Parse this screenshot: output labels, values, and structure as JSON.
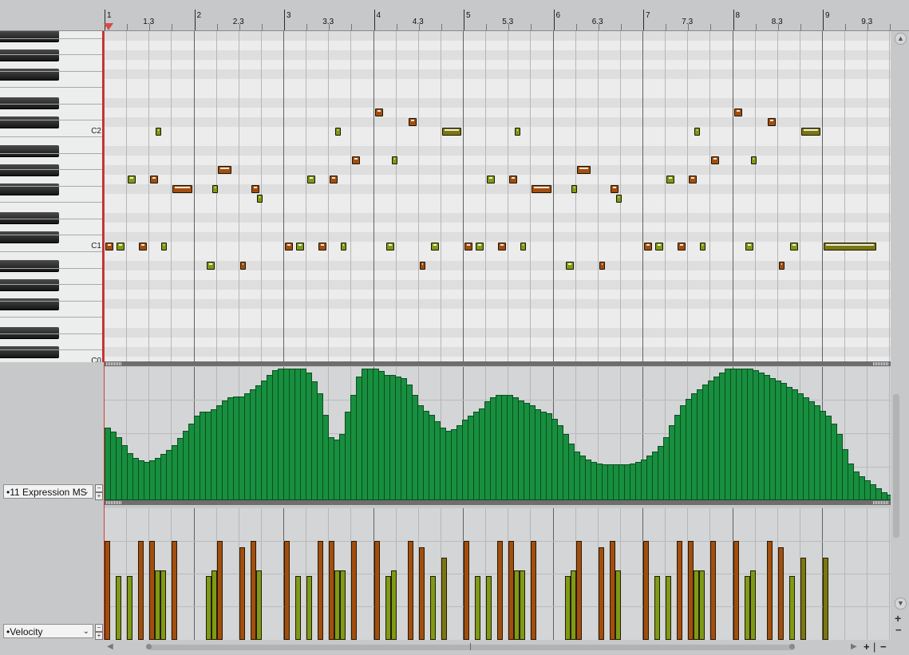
{
  "ruler": {
    "labels": [
      "1",
      "1.3",
      "2",
      "2.3",
      "3",
      "3.3",
      "4",
      "4.3",
      "5",
      "5.3",
      "6",
      "6.3",
      "7",
      "7.3",
      "8",
      "8.3",
      "9",
      "9.3"
    ]
  },
  "keyboard": {
    "labels": [
      "C2",
      "C1",
      "C0"
    ]
  },
  "notes": [
    {
      "bar": 1,
      "beat": 1.0,
      "len": 0.5,
      "pitch": "C1",
      "vel": "orange"
    },
    {
      "bar": 1,
      "beat": 1.5,
      "len": 0.5,
      "pitch": "C1",
      "vel": "green"
    },
    {
      "bar": 1,
      "beat": 2.0,
      "len": 0.5,
      "pitch": "G1",
      "vel": "green"
    },
    {
      "bar": 1,
      "beat": 2.5,
      "len": 0.5,
      "pitch": "C1",
      "vel": "orange"
    },
    {
      "bar": 1,
      "beat": 3.0,
      "len": 0.5,
      "pitch": "G1",
      "vel": "orange"
    },
    {
      "bar": 1,
      "beat": 3.25,
      "len": 0.25,
      "pitch": "C2",
      "vel": "green"
    },
    {
      "bar": 1,
      "beat": 3.5,
      "len": 0.25,
      "pitch": "C1",
      "vel": "green"
    },
    {
      "bar": 1,
      "beat": 4.0,
      "len": 1.0,
      "pitch": "F#1",
      "vel": "orange"
    },
    {
      "bar": 2,
      "beat": 1.5,
      "len": 0.5,
      "pitch": "A#0",
      "vel": "green"
    },
    {
      "bar": 2,
      "beat": 1.75,
      "len": 0.25,
      "pitch": "F#1",
      "vel": "green"
    },
    {
      "bar": 2,
      "beat": 2.0,
      "len": 0.75,
      "pitch": "G#1",
      "vel": "orange"
    },
    {
      "bar": 2,
      "beat": 3.0,
      "len": 0.25,
      "pitch": "A#0",
      "vel": "orange"
    },
    {
      "bar": 2,
      "beat": 3.5,
      "len": 0.5,
      "pitch": "F#1",
      "vel": "orange"
    },
    {
      "bar": 2,
      "beat": 3.75,
      "len": 0.25,
      "pitch": "F1",
      "vel": "green"
    },
    {
      "bar": 3,
      "beat": 1.0,
      "len": 0.5,
      "pitch": "C1",
      "vel": "orange"
    },
    {
      "bar": 3,
      "beat": 1.5,
      "len": 0.5,
      "pitch": "C1",
      "vel": "green"
    },
    {
      "bar": 3,
      "beat": 2.0,
      "len": 0.5,
      "pitch": "G1",
      "vel": "green"
    },
    {
      "bar": 3,
      "beat": 2.5,
      "len": 0.5,
      "pitch": "C1",
      "vel": "orange"
    },
    {
      "bar": 3,
      "beat": 3.0,
      "len": 0.5,
      "pitch": "G1",
      "vel": "orange"
    },
    {
      "bar": 3,
      "beat": 3.25,
      "len": 0.25,
      "pitch": "C2",
      "vel": "green"
    },
    {
      "bar": 3,
      "beat": 3.5,
      "len": 0.25,
      "pitch": "C1",
      "vel": "green"
    },
    {
      "bar": 3,
      "beat": 4.0,
      "len": 0.5,
      "pitch": "A1",
      "vel": "orange"
    },
    {
      "bar": 4,
      "beat": 1.0,
      "len": 0.5,
      "pitch": "D2",
      "vel": "orange"
    },
    {
      "bar": 4,
      "beat": 1.5,
      "len": 0.5,
      "pitch": "C1",
      "vel": "green"
    },
    {
      "bar": 4,
      "beat": 1.75,
      "len": 0.25,
      "pitch": "A1",
      "vel": "green"
    },
    {
      "bar": 4,
      "beat": 2.5,
      "len": 0.5,
      "pitch": "C#2",
      "vel": "orange"
    },
    {
      "bar": 4,
      "beat": 3.0,
      "len": 0.25,
      "pitch": "A#0",
      "vel": "orange"
    },
    {
      "bar": 4,
      "beat": 3.5,
      "len": 0.5,
      "pitch": "C1",
      "vel": "green"
    },
    {
      "bar": 4,
      "beat": 4.0,
      "len": 1.0,
      "pitch": "C2",
      "vel": "olive"
    },
    {
      "bar": 5,
      "beat": 1.0,
      "len": 0.5,
      "pitch": "C1",
      "vel": "orange"
    },
    {
      "bar": 5,
      "beat": 1.5,
      "len": 0.5,
      "pitch": "C1",
      "vel": "green"
    },
    {
      "bar": 5,
      "beat": 2.0,
      "len": 0.5,
      "pitch": "G1",
      "vel": "green"
    },
    {
      "bar": 5,
      "beat": 2.5,
      "len": 0.5,
      "pitch": "C1",
      "vel": "orange"
    },
    {
      "bar": 5,
      "beat": 3.0,
      "len": 0.5,
      "pitch": "G1",
      "vel": "orange"
    },
    {
      "bar": 5,
      "beat": 3.25,
      "len": 0.25,
      "pitch": "C2",
      "vel": "green"
    },
    {
      "bar": 5,
      "beat": 3.5,
      "len": 0.25,
      "pitch": "C1",
      "vel": "green"
    },
    {
      "bar": 5,
      "beat": 4.0,
      "len": 1.0,
      "pitch": "F#1",
      "vel": "orange"
    },
    {
      "bar": 6,
      "beat": 1.5,
      "len": 0.5,
      "pitch": "A#0",
      "vel": "green"
    },
    {
      "bar": 6,
      "beat": 1.75,
      "len": 0.25,
      "pitch": "F#1",
      "vel": "green"
    },
    {
      "bar": 6,
      "beat": 2.0,
      "len": 0.75,
      "pitch": "G#1",
      "vel": "orange"
    },
    {
      "bar": 6,
      "beat": 3.0,
      "len": 0.25,
      "pitch": "A#0",
      "vel": "orange"
    },
    {
      "bar": 6,
      "beat": 3.5,
      "len": 0.5,
      "pitch": "F#1",
      "vel": "orange"
    },
    {
      "bar": 6,
      "beat": 3.75,
      "len": 0.25,
      "pitch": "F1",
      "vel": "green"
    },
    {
      "bar": 7,
      "beat": 1.0,
      "len": 0.5,
      "pitch": "C1",
      "vel": "orange"
    },
    {
      "bar": 7,
      "beat": 1.5,
      "len": 0.5,
      "pitch": "C1",
      "vel": "green"
    },
    {
      "bar": 7,
      "beat": 2.0,
      "len": 0.5,
      "pitch": "G1",
      "vel": "green"
    },
    {
      "bar": 7,
      "beat": 2.5,
      "len": 0.5,
      "pitch": "C1",
      "vel": "orange"
    },
    {
      "bar": 7,
      "beat": 3.0,
      "len": 0.5,
      "pitch": "G1",
      "vel": "orange"
    },
    {
      "bar": 7,
      "beat": 3.25,
      "len": 0.25,
      "pitch": "C2",
      "vel": "green"
    },
    {
      "bar": 7,
      "beat": 3.5,
      "len": 0.25,
      "pitch": "C1",
      "vel": "green"
    },
    {
      "bar": 7,
      "beat": 4.0,
      "len": 0.5,
      "pitch": "A1",
      "vel": "orange"
    },
    {
      "bar": 8,
      "beat": 1.0,
      "len": 0.5,
      "pitch": "D2",
      "vel": "orange"
    },
    {
      "bar": 8,
      "beat": 1.5,
      "len": 0.5,
      "pitch": "C1",
      "vel": "green"
    },
    {
      "bar": 8,
      "beat": 1.75,
      "len": 0.25,
      "pitch": "A1",
      "vel": "green"
    },
    {
      "bar": 8,
      "beat": 2.5,
      "len": 0.5,
      "pitch": "C#2",
      "vel": "orange"
    },
    {
      "bar": 8,
      "beat": 3.0,
      "len": 0.25,
      "pitch": "A#0",
      "vel": "orange"
    },
    {
      "bar": 8,
      "beat": 3.5,
      "len": 0.5,
      "pitch": "C1",
      "vel": "green"
    },
    {
      "bar": 8,
      "beat": 4.0,
      "len": 1.0,
      "pitch": "C2",
      "vel": "olive"
    },
    {
      "bar": 9,
      "beat": 1.0,
      "len": 2.5,
      "pitch": "C1",
      "vel": "olive"
    }
  ],
  "cc_lane": {
    "selector_label": "•11 Expression MS",
    "values": [
      0.55,
      0.52,
      0.48,
      0.42,
      0.36,
      0.32,
      0.3,
      0.29,
      0.3,
      0.32,
      0.35,
      0.38,
      0.42,
      0.47,
      0.53,
      0.58,
      0.64,
      0.67,
      0.67,
      0.69,
      0.72,
      0.76,
      0.78,
      0.79,
      0.79,
      0.81,
      0.84,
      0.87,
      0.91,
      0.95,
      0.99,
      1.0,
      1.0,
      1.0,
      1.0,
      1.0,
      0.97,
      0.9,
      0.81,
      0.65,
      0.48,
      0.46,
      0.5,
      0.67,
      0.8,
      0.94,
      1.0,
      1.0,
      1.0,
      0.98,
      0.95,
      0.95,
      0.94,
      0.93,
      0.88,
      0.8,
      0.72,
      0.68,
      0.65,
      0.6,
      0.55,
      0.53,
      0.54,
      0.57,
      0.61,
      0.64,
      0.67,
      0.7,
      0.75,
      0.78,
      0.8,
      0.8,
      0.8,
      0.78,
      0.76,
      0.74,
      0.72,
      0.69,
      0.67,
      0.66,
      0.62,
      0.57,
      0.5,
      0.43,
      0.37,
      0.34,
      0.31,
      0.29,
      0.28,
      0.27,
      0.27,
      0.27,
      0.27,
      0.27,
      0.28,
      0.29,
      0.31,
      0.34,
      0.37,
      0.41,
      0.48,
      0.57,
      0.65,
      0.72,
      0.77,
      0.81,
      0.84,
      0.88,
      0.91,
      0.94,
      0.97,
      1.0,
      1.0,
      1.0,
      1.0,
      1.0,
      0.99,
      0.97,
      0.95,
      0.93,
      0.91,
      0.89,
      0.86,
      0.84,
      0.81,
      0.78,
      0.75,
      0.72,
      0.68,
      0.64,
      0.58,
      0.5,
      0.39,
      0.28,
      0.22,
      0.18,
      0.15,
      0.12,
      0.09,
      0.06,
      0.04,
      0.02,
      0.01,
      0.01
    ]
  },
  "velocity_lane": {
    "selector_label": "•Velocity",
    "colors": {
      "orange": "#a24e0f",
      "green": "#7d9b16",
      "olive": "#7a7712"
    }
  }
}
